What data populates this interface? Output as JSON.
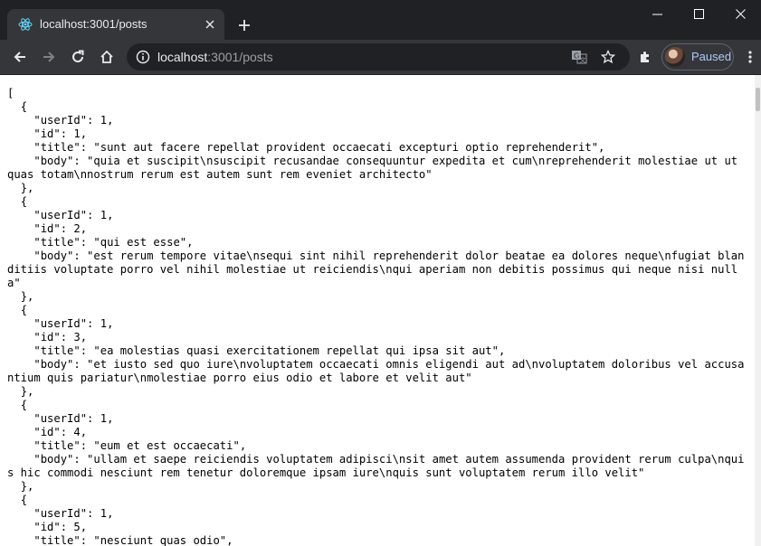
{
  "colors": {
    "titlebar": "#202124",
    "toolbar": "#35363a",
    "omnibox": "#202124",
    "text_primary": "#e8eaed",
    "text_secondary": "#9aa0a6",
    "profile_accent": "#aecbfa",
    "page_background": "#ffffff"
  },
  "tab": {
    "title": "localhost:3001/posts",
    "favicon": "react-icon",
    "close_icon": "close-icon"
  },
  "window_controls": [
    "minimize-icon",
    "maximize-icon",
    "close-icon"
  ],
  "toolbar": {
    "url_host": "localhost",
    "url_rest": ":3001/posts",
    "profile_label": "Paused",
    "icons": [
      "back-icon",
      "forward-icon",
      "reload-icon",
      "home-icon",
      "info-icon",
      "translate-icon",
      "star-icon",
      "extensions-icon",
      "menu-icon"
    ]
  },
  "page": {
    "json_text": "[\n  {\n    \"userId\": 1,\n    \"id\": 1,\n    \"title\": \"sunt aut facere repellat provident occaecati excepturi optio reprehenderit\",\n    \"body\": \"quia et suscipit\\nsuscipit recusandae consequuntur expedita et cum\\nreprehenderit molestiae ut ut quas totam\\nnostrum rerum est autem sunt rem eveniet architecto\"\n  },\n  {\n    \"userId\": 1,\n    \"id\": 2,\n    \"title\": \"qui est esse\",\n    \"body\": \"est rerum tempore vitae\\nsequi sint nihil reprehenderit dolor beatae ea dolores neque\\nfugiat blanditiis voluptate porro vel nihil molestiae ut reiciendis\\nqui aperiam non debitis possimus qui neque nisi nulla\"\n  },\n  {\n    \"userId\": 1,\n    \"id\": 3,\n    \"title\": \"ea molestias quasi exercitationem repellat qui ipsa sit aut\",\n    \"body\": \"et iusto sed quo iure\\nvoluptatem occaecati omnis eligendi aut ad\\nvoluptatem doloribus vel accusantium quis pariatur\\nmolestiae porro eius odio et labore et velit aut\"\n  },\n  {\n    \"userId\": 1,\n    \"id\": 4,\n    \"title\": \"eum et est occaecati\",\n    \"body\": \"ullam et saepe reiciendis voluptatem adipisci\\nsit amet autem assumenda provident rerum culpa\\nquis hic commodi nesciunt rem tenetur doloremque ipsam iure\\nquis sunt voluptatem rerum illo velit\"\n  },\n  {\n    \"userId\": 1,\n    \"id\": 5,\n    \"title\": \"nesciunt quas odio\","
  }
}
